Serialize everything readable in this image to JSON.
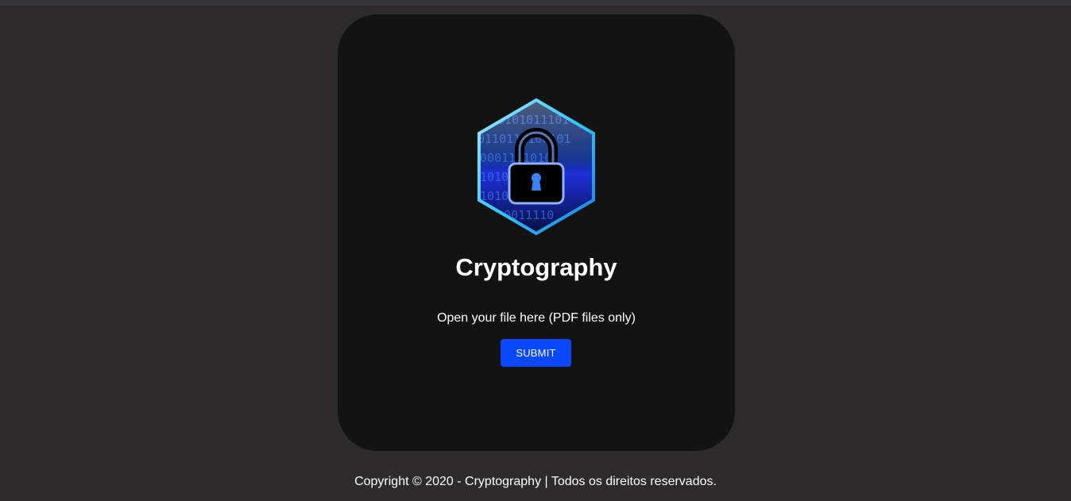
{
  "page": {
    "title": "Cryptography",
    "colors": {
      "background": "#2d2b2c",
      "card": "#131313",
      "accent": "#0a48ff",
      "text": "#ffffff"
    }
  },
  "card": {
    "logo_icon": "hexagon-lock-binary-icon",
    "title": "Cryptography",
    "file_label": "Open your file here (PDF files only)",
    "submit_label": "SUBMIT"
  },
  "footer": {
    "copyright": "Copyright © 2020 - Cryptography | Todos os direitos reservados."
  }
}
